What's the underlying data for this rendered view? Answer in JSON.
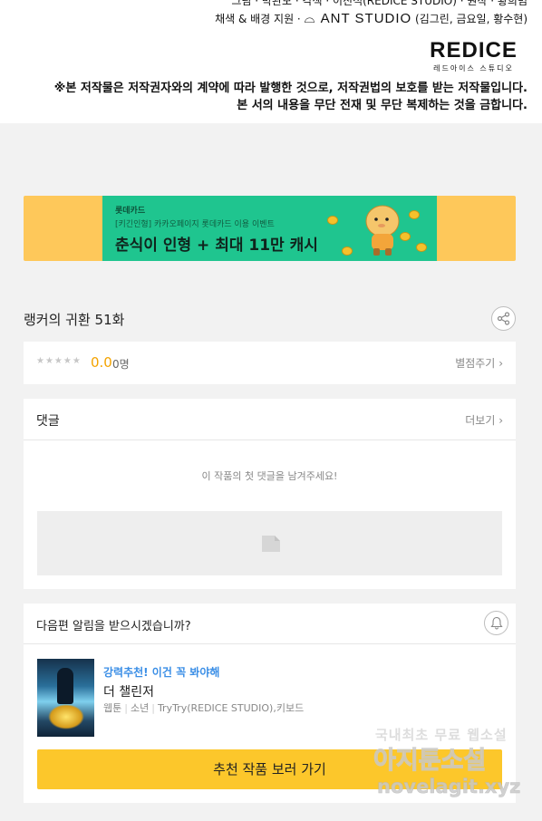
{
  "credits": {
    "line1": "그림 · 박완모 · 각색 · 이진석(REDICE STUDIO) · 원작 · 황희범",
    "line2_prefix": "채색 & 배경 지원 · ",
    "line2_studio": "ANT STUDIO",
    "line2_suffix": " (김그린, 금요일, 황수현)",
    "logo_text": "REDICE",
    "logo_sub": "레드아이스 스튜디오",
    "notice1": "※본 저작물은 저작권자와의 계약에 따라 발행한 것으로, 저작권법의 보호를 받는 저작물입니다.",
    "notice2": "본 서의 내용을 무단 전재 및 무단 복제하는 것을 금합니다."
  },
  "ad": {
    "brand": "롯데카드",
    "sub": "[키긴인형] 카카오페이지 롯데카드 이용 이벤트",
    "headline": "춘식이 인형 + 최대 11만 캐시",
    "colors": {
      "outer": "#fec85a",
      "inner": "#1fc58f"
    }
  },
  "episode": {
    "title": "랭커의 귀환 51화",
    "share_icon": "share-icon"
  },
  "rating": {
    "stars": "★★★★★",
    "score": "0.0",
    "count": "0명",
    "rate_link": "별점주기"
  },
  "comments": {
    "title": "댓글",
    "more": "더보기",
    "empty_message": "이 작품의 첫 댓글을 남겨주세요!"
  },
  "reco": {
    "question": "다음편 알림을 받으시겠습니까?",
    "tag": "강력추천! 이건 꼭 봐야해",
    "name": "더 챌린저",
    "meta_genre": "웹툰",
    "meta_sub": "소년",
    "meta_authors": "TryTry(REDICE STUDIO),키보드",
    "cta": "추천 작품 보러 가기",
    "accent": "#fcc72b",
    "tag_color": "#3a8ee6"
  },
  "watermark": {
    "line1": "국내최초 무료 웹소설",
    "line2": "아지툰소설",
    "line3": "novelagit.xyz"
  }
}
